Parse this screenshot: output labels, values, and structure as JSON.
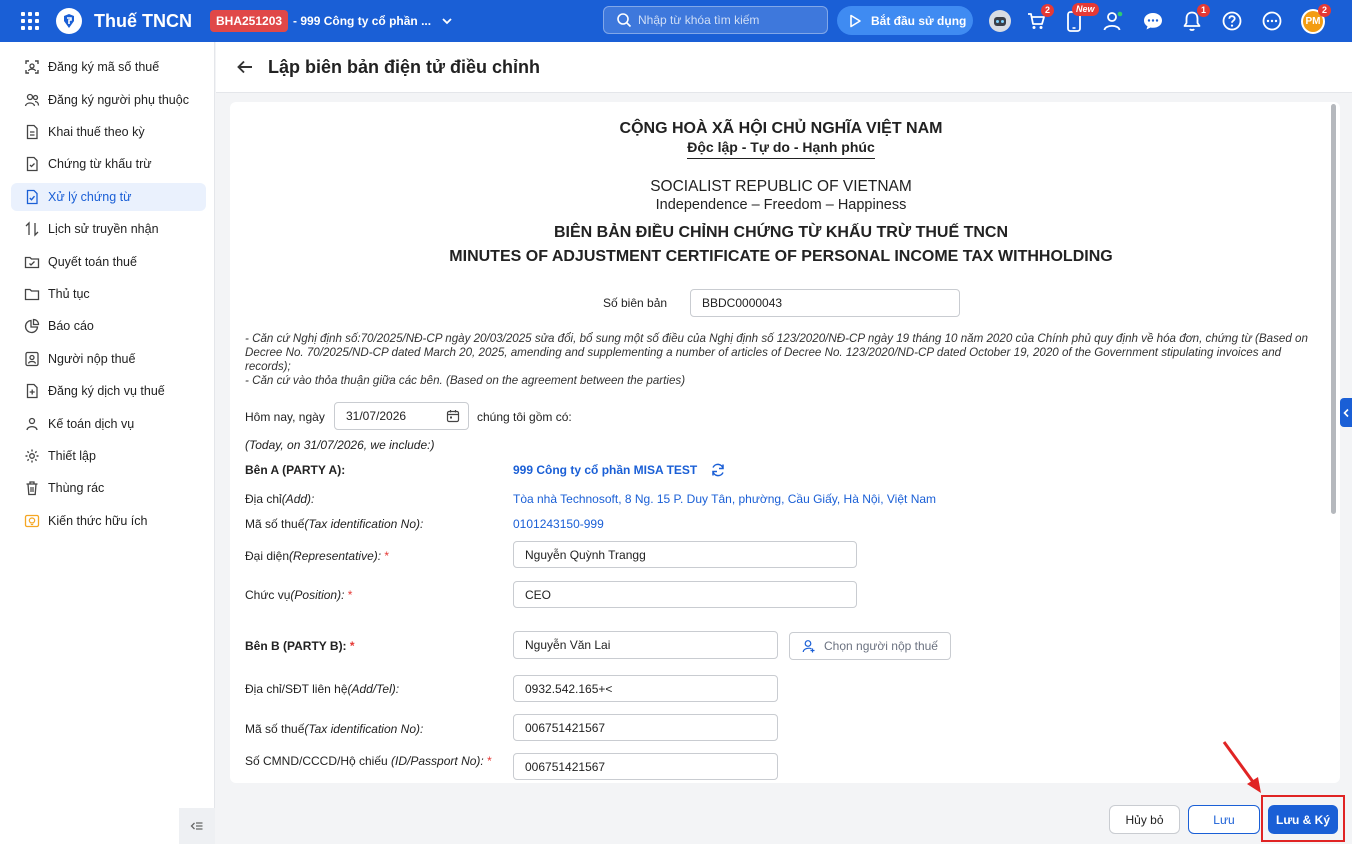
{
  "topbar": {
    "app_title": "Thuế TNCN",
    "company_code": "BHA251203",
    "company_name": "- 999 Công ty cổ phần ...",
    "search_placeholder": "Nhập từ khóa tìm kiếm",
    "start_button": "Bắt đầu sử dụng",
    "cart_badge": "2",
    "new_badge": "New",
    "notification_badge": "1",
    "avatar_initials": "PM",
    "avatar_badge": "2"
  },
  "sidebar": {
    "items": [
      {
        "label": "Đăng ký mã số thuế",
        "icon": "scan-icon"
      },
      {
        "label": "Đăng ký người phụ thuộc",
        "icon": "users-icon"
      },
      {
        "label": "Khai thuế theo kỳ",
        "icon": "document-icon"
      },
      {
        "label": "Chứng từ khấu trừ",
        "icon": "receipt-icon"
      },
      {
        "label": "Xử lý chứng từ",
        "icon": "file-check-icon"
      },
      {
        "label": "Lịch sử truyền nhận",
        "icon": "transfer-icon"
      },
      {
        "label": "Quyết toán thuế",
        "icon": "folder-check-icon"
      },
      {
        "label": "Thủ tục",
        "icon": "folder-icon"
      },
      {
        "label": "Báo cáo",
        "icon": "pie-chart-icon"
      },
      {
        "label": "Người nộp thuế",
        "icon": "person-card-icon"
      },
      {
        "label": "Đăng ký dịch vụ thuế",
        "icon": "file-plus-icon"
      },
      {
        "label": "Kế toán dịch vụ",
        "icon": "group-icon"
      },
      {
        "label": "Thiết lập",
        "icon": "gear-icon"
      },
      {
        "label": "Thùng rác",
        "icon": "trash-icon"
      },
      {
        "label": "Kiến thức hữu ích",
        "icon": "lightbulb-icon"
      }
    ],
    "active_index": 4
  },
  "header": {
    "title": "Lập biên bản điện tử điều chỉnh"
  },
  "doc": {
    "national_title": "CỘNG HOÀ XÃ HỘI CHỦ NGHĨA VIỆT NAM",
    "motto": "Độc lập - Tự do - Hạnh phúc",
    "national_title_en": "SOCIALIST REPUBLIC OF VIETNAM",
    "motto_en": "Independence – Freedom – Happiness",
    "heading_vi": "BIÊN BẢN ĐIỀU CHỈNH CHỨNG TỪ KHẤU TRỪ THUẾ TNCN",
    "heading_en": "MINUTES OF ADJUSTMENT CERTIFICATE OF PERSONAL INCOME TAX WITHHOLDING",
    "record_no_label": "Số biên bản",
    "record_no_value": "BBDC0000043",
    "basis_1": "- Căn cứ Nghị định số:70/2025/NĐ-CP ngày 20/03/2025 sửa đổi, bổ sung một số điều của Nghị định số 123/2020/NĐ-CP ngày 19 tháng 10 năm 2020 của Chính phủ quy định về hóa đơn, chứng từ (Based on Decree No. 70/2025/ND-CP dated March 20, 2025, amending and supplementing a number of articles of Decree No. 123/2020/ND-CP dated October 19, 2020 of the Government stipulating invoices and records);",
    "basis_2": "- Căn cứ vào thỏa thuận giữa các bên. (Based on the agreement between the parties)",
    "today_label": "Hôm nay, ngày",
    "today_value": "31/07/2026",
    "include_label": "chúng tôi gồm có:",
    "today_en": "(Today, on 31/07/2026, we include:)",
    "party_a_label": "Bên A (PARTY A):",
    "party_a_name": "999 Công ty cổ phần MISA TEST",
    "address_label": "Địa chỉ",
    "address_label_en": "(Add):",
    "address_value": "Tòa nhà Technosoft, 8 Ng. 15 P. Duy Tân, phường, Cầu Giấy, Hà Nội, Việt Nam",
    "tax_id_label": "Mã số thuế",
    "tax_id_label_en": "(Tax identification No):",
    "tax_id_value": "0101243150-999",
    "rep_label": "Đại diện",
    "rep_label_en": "(Representative):",
    "rep_value": "Nguyễn Quỳnh Trangg",
    "position_label": "Chức vụ",
    "position_label_en": "(Position):",
    "position_value": "CEO",
    "party_b_label": "Bên B (PARTY B):",
    "party_b_value": "Nguyễn Văn Lai",
    "pick_taxpayer": "Chọn người nộp thuế",
    "contact_label": "Địa chỉ/SĐT liên hệ",
    "contact_label_en": "(Add/Tel):",
    "contact_value": "0932.542.165+<",
    "b_tax_label": "Mã số thuế",
    "b_tax_label_en": "(Tax identification No):",
    "b_tax_value": "006751421567",
    "id_label": "Số CMND/CCCD/Hộ chiếu ",
    "id_label_en": "(ID/Passport No):",
    "id_value": "006751421567",
    "required_mark": "*"
  },
  "footer": {
    "cancel": "Hủy bỏ",
    "save": "Lưu",
    "save_sign": "Lưu & Ký"
  },
  "colors": {
    "primary": "#1a5fd6",
    "badge_red": "#e53935",
    "highlight": "#e02424"
  }
}
